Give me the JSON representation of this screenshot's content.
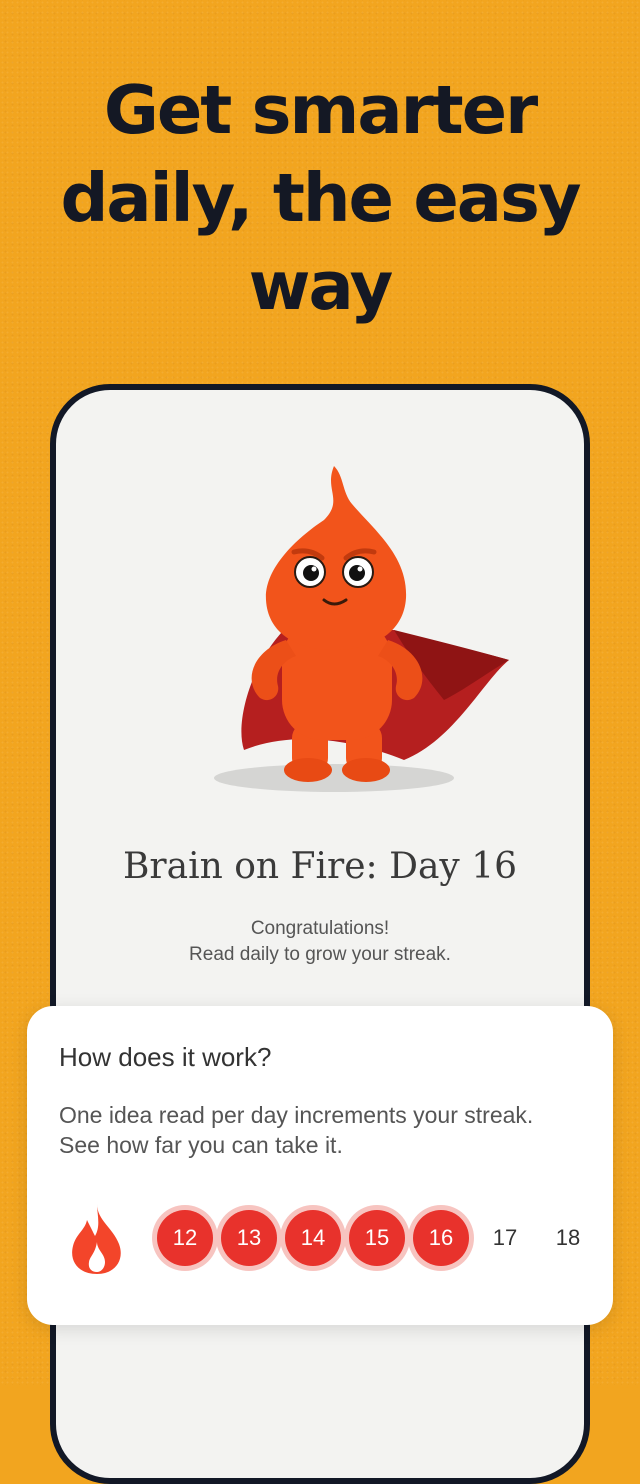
{
  "headline": {
    "line1": "Get smarter",
    "line2": "daily, the easy",
    "line3": "way"
  },
  "screen": {
    "title": "Brain on Fire: Day 16",
    "subtitle_line1": "Congratulations!",
    "subtitle_line2": "Read daily to grow your streak."
  },
  "info_card": {
    "title": "How does it work?",
    "body_line1": "One idea read per day increments your streak.",
    "body_line2": "See how far you can take it.",
    "days": [
      {
        "label": "12",
        "completed": true
      },
      {
        "label": "13",
        "completed": true
      },
      {
        "label": "14",
        "completed": true
      },
      {
        "label": "15",
        "completed": true
      },
      {
        "label": "16",
        "completed": true
      },
      {
        "label": "17",
        "completed": false
      },
      {
        "label": "18",
        "completed": false
      }
    ]
  },
  "colors": {
    "background": "#F2A51F",
    "headline": "#141824",
    "streak_red": "#E8322C",
    "mascot_orange": "#F2541B",
    "cape_red": "#B51F1F"
  },
  "icons": {
    "mascot": "fire-mascot-illustration",
    "flame": "flame-icon"
  }
}
